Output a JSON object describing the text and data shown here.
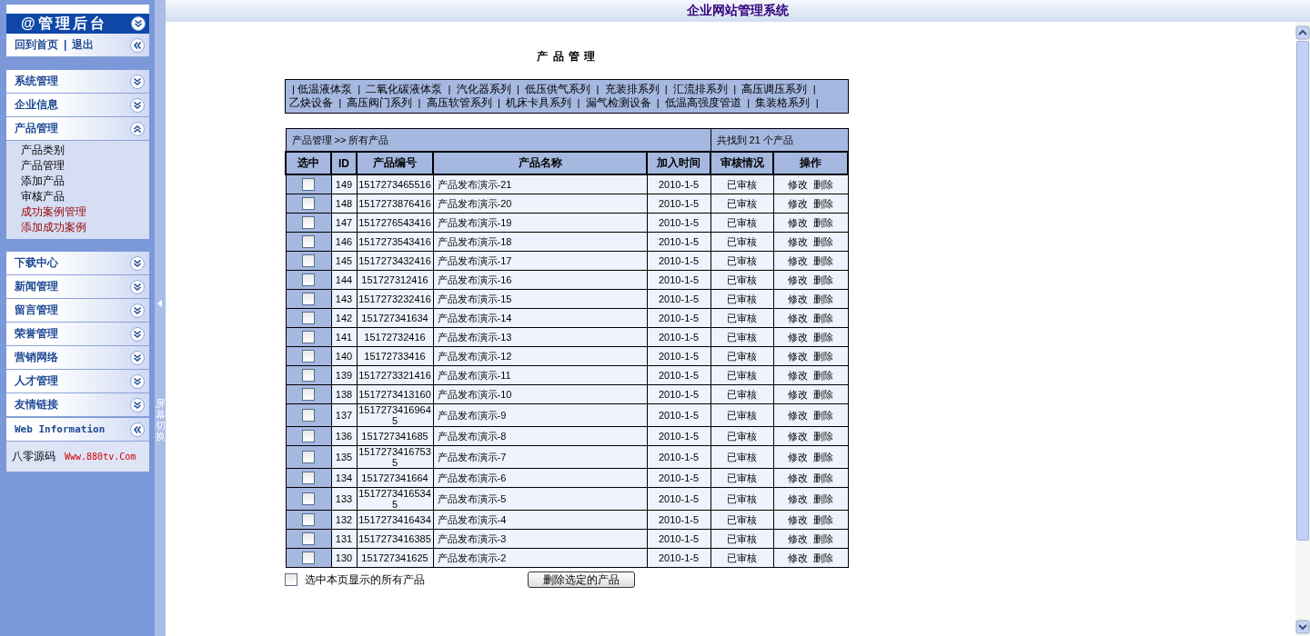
{
  "sidebar": {
    "header": {
      "title": "@管理后台",
      "expanded": true
    },
    "quick_links": [
      "回到首页",
      "退出"
    ],
    "quick_separator": "|",
    "blocks": [
      {
        "groups": [
          {
            "title": "系统管理",
            "expanded": false
          },
          {
            "title": "企业信息",
            "expanded": false
          },
          {
            "title": "产品管理",
            "expanded": true,
            "items": [
              {
                "label": "产品类别",
                "kind": "plain"
              },
              {
                "label": "产品管理",
                "kind": "plain"
              },
              {
                "label": "添加产品",
                "kind": "plain"
              },
              {
                "label": "审核产品",
                "kind": "plain"
              },
              {
                "label": "成功案例管理",
                "kind": "highlight"
              },
              {
                "label": "添加成功案例",
                "kind": "highlight"
              }
            ]
          }
        ]
      },
      {
        "groups": [
          {
            "title": "下载中心",
            "expanded": false
          },
          {
            "title": "新闻管理",
            "expanded": false
          },
          {
            "title": "留言管理",
            "expanded": false
          },
          {
            "title": "荣誉管理",
            "expanded": false
          },
          {
            "title": "营销网络",
            "expanded": false
          },
          {
            "title": "人才管理",
            "expanded": false
          },
          {
            "title": "友情链接",
            "expanded": false
          }
        ]
      }
    ],
    "info": {
      "title": "Web Information",
      "text": "八零源码",
      "link": "Www.880tv.Com"
    },
    "toggle": "屏幕切换"
  },
  "top_bar": {
    "title": "企业网站管理系统"
  },
  "page_title": "产 品 管 理",
  "categories": {
    "separator": "|",
    "items": [
      "低温液体泵",
      "二氧化碳液体泵",
      "汽化器系列",
      "低压供气系列",
      "充装排系列",
      "汇流排系列",
      "高压调压系列",
      "乙炔设备",
      "高压阀门系列",
      "高压软管系列",
      "机床卡具系列",
      "漏气检测设备",
      "低温高强度管道",
      "集装格系列"
    ]
  },
  "table": {
    "breadcrumb": "产品管理 >> 所有产品",
    "count": "共找到 21 个产品",
    "columns": [
      "选中",
      "ID",
      "产品编号",
      "产品名称",
      "加入时间",
      "审核情况",
      "操作"
    ],
    "rows": [
      {
        "checked": false,
        "id": "149",
        "code": "1517273465516",
        "name": "产品发布演示-21",
        "date": "2010-1-5",
        "status": "已审核",
        "actions": [
          "修改",
          "删除"
        ]
      },
      {
        "checked": false,
        "id": "148",
        "code": "1517273876416",
        "name": "产品发布演示-20",
        "date": "2010-1-5",
        "status": "已审核",
        "actions": [
          "修改",
          "删除"
        ]
      },
      {
        "checked": false,
        "id": "147",
        "code": "1517276543416",
        "name": "产品发布演示-19",
        "date": "2010-1-5",
        "status": "已审核",
        "actions": [
          "修改",
          "删除"
        ]
      },
      {
        "checked": false,
        "id": "146",
        "code": "1517273543416",
        "name": "产品发布演示-18",
        "date": "2010-1-5",
        "status": "已审核",
        "actions": [
          "修改",
          "删除"
        ]
      },
      {
        "checked": false,
        "id": "145",
        "code": "1517273432416",
        "name": "产品发布演示-17",
        "date": "2010-1-5",
        "status": "已审核",
        "actions": [
          "修改",
          "删除"
        ]
      },
      {
        "checked": false,
        "id": "144",
        "code": "151727312416",
        "name": "产品发布演示-16",
        "date": "2010-1-5",
        "status": "已审核",
        "actions": [
          "修改",
          "删除"
        ]
      },
      {
        "checked": false,
        "id": "143",
        "code": "1517273232416",
        "name": "产品发布演示-15",
        "date": "2010-1-5",
        "status": "已审核",
        "actions": [
          "修改",
          "删除"
        ]
      },
      {
        "checked": false,
        "id": "142",
        "code": "151727341634",
        "name": "产品发布演示-14",
        "date": "2010-1-5",
        "status": "已审核",
        "actions": [
          "修改",
          "删除"
        ]
      },
      {
        "checked": false,
        "id": "141",
        "code": "15172732416",
        "name": "产品发布演示-13",
        "date": "2010-1-5",
        "status": "已审核",
        "actions": [
          "修改",
          "删除"
        ]
      },
      {
        "checked": false,
        "id": "140",
        "code": "15172733416",
        "name": "产品发布演示-12",
        "date": "2010-1-5",
        "status": "已审核",
        "actions": [
          "修改",
          "删除"
        ]
      },
      {
        "checked": false,
        "id": "139",
        "code": "1517273321416",
        "name": "产品发布演示-11",
        "date": "2010-1-5",
        "status": "已审核",
        "actions": [
          "修改",
          "删除"
        ]
      },
      {
        "checked": false,
        "id": "138",
        "code": "1517273413160",
        "name": "产品发布演示-10",
        "date": "2010-1-5",
        "status": "已审核",
        "actions": [
          "修改",
          "删除"
        ]
      },
      {
        "checked": false,
        "id": "137",
        "code": "15172734169645",
        "name": "产品发布演示-9",
        "date": "2010-1-5",
        "status": "已审核",
        "actions": [
          "修改",
          "删除"
        ]
      },
      {
        "checked": false,
        "id": "136",
        "code": "151727341685",
        "name": "产品发布演示-8",
        "date": "2010-1-5",
        "status": "已审核",
        "actions": [
          "修改",
          "删除"
        ]
      },
      {
        "checked": false,
        "id": "135",
        "code": "15172734167535",
        "name": "产品发布演示-7",
        "date": "2010-1-5",
        "status": "已审核",
        "actions": [
          "修改",
          "删除"
        ]
      },
      {
        "checked": false,
        "id": "134",
        "code": "151727341664",
        "name": "产品发布演示-6",
        "date": "2010-1-5",
        "status": "已审核",
        "actions": [
          "修改",
          "删除"
        ]
      },
      {
        "checked": false,
        "id": "133",
        "code": "15172734165345",
        "name": "产品发布演示-5",
        "date": "2010-1-5",
        "status": "已审核",
        "actions": [
          "修改",
          "删除"
        ]
      },
      {
        "checked": false,
        "id": "132",
        "code": "1517273416434",
        "name": "产品发布演示-4",
        "date": "2010-1-5",
        "status": "已审核",
        "actions": [
          "修改",
          "删除"
        ]
      },
      {
        "checked": false,
        "id": "131",
        "code": "1517273416385",
        "name": "产品发布演示-3",
        "date": "2010-1-5",
        "status": "已审核",
        "actions": [
          "修改",
          "删除"
        ]
      },
      {
        "checked": false,
        "id": "130",
        "code": "151727341625",
        "name": "产品发布演示-2",
        "date": "2010-1-5",
        "status": "已审核",
        "actions": [
          "修改",
          "删除"
        ]
      }
    ]
  },
  "footer": {
    "select_all": {
      "label": "选中本页显示的所有产品",
      "checked": false
    },
    "delete_button": "删除选定的产品"
  }
}
